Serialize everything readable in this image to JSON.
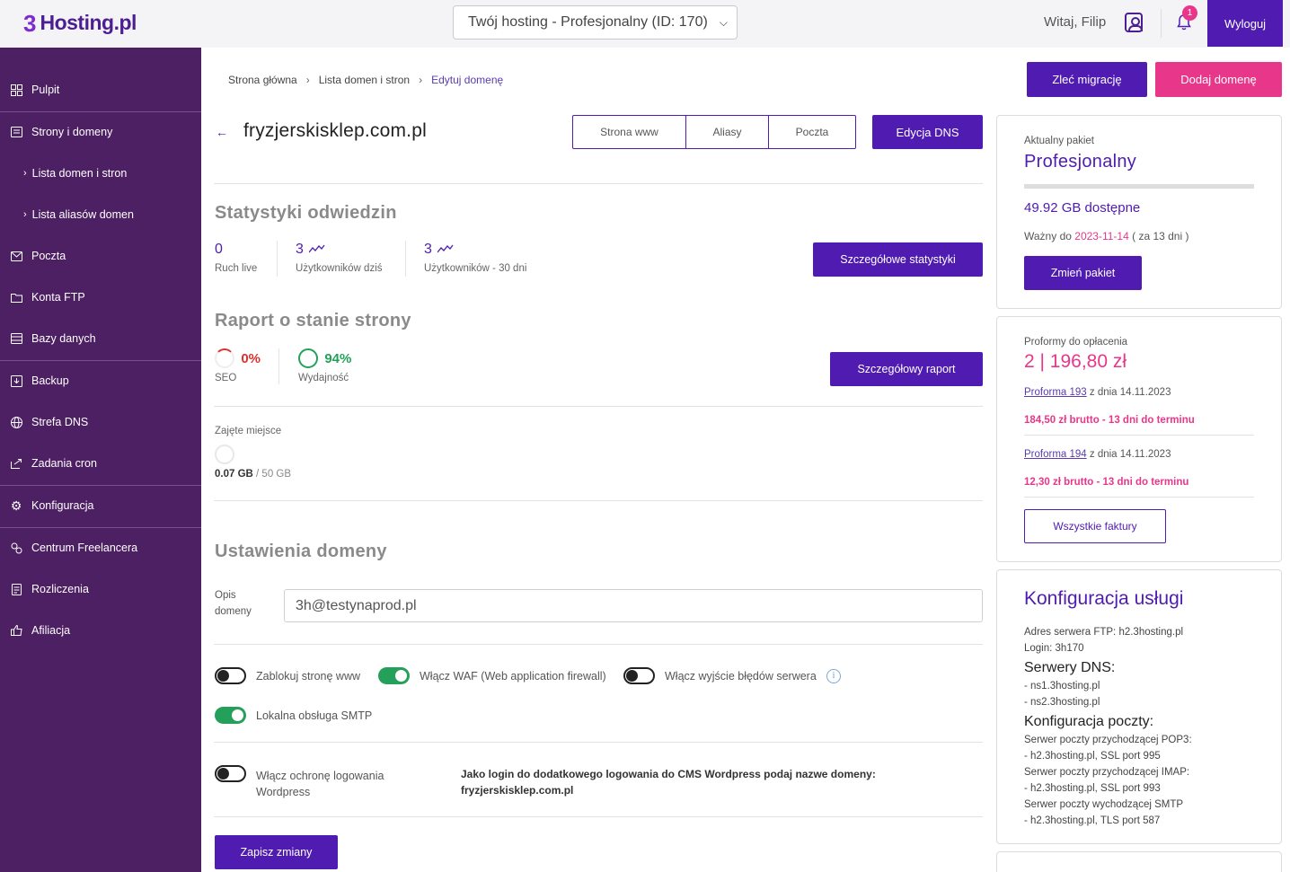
{
  "header": {
    "logo_mark": "3",
    "logo_text": "Hosting.pl",
    "hosting_select": "Twój hosting - Profesjonalny (ID: 170)",
    "greeting": "Witaj, Filip",
    "notifications_count": "1",
    "logout_label": "Wyloguj"
  },
  "sidebar": {
    "items": [
      {
        "label": "Pulpit",
        "icon": "dashboard-icon"
      },
      {
        "label": "Strony i domeny",
        "icon": "globe-list-icon"
      },
      {
        "label": "Lista domen i stron",
        "icon": "chevron-right-icon"
      },
      {
        "label": "Lista aliasów domen",
        "icon": "chevron-right-icon"
      },
      {
        "label": "Poczta",
        "icon": "mail-icon"
      },
      {
        "label": "Konta FTP",
        "icon": "folder-icon"
      },
      {
        "label": "Bazy danych",
        "icon": "database-icon"
      },
      {
        "label": "Backup",
        "icon": "backup-icon"
      },
      {
        "label": "Strefa DNS",
        "icon": "dns-icon"
      },
      {
        "label": "Zadania cron",
        "icon": "cron-icon"
      },
      {
        "label": "Konfiguracja",
        "icon": "gear-icon"
      },
      {
        "label": "Centrum Freelancera",
        "icon": "freelancer-icon"
      },
      {
        "label": "Rozliczenia",
        "icon": "invoice-icon"
      },
      {
        "label": "Afiliacja",
        "icon": "thumbs-up-icon"
      }
    ]
  },
  "breadcrumb": {
    "items": [
      "Strona główna",
      "Lista domen i stron",
      "Edytuj domenę"
    ]
  },
  "actions": {
    "migrate_label": "Zleć migrację",
    "add_domain_label": "Dodaj domenę"
  },
  "domain": {
    "name": "fryzjerskisklep.com.pl",
    "tabs": [
      "Strona www",
      "Aliasy",
      "Poczta"
    ],
    "dns_button": "Edycja DNS"
  },
  "stats": {
    "title": "Statystyki odwiedzin",
    "items": [
      {
        "value": "0",
        "label": "Ruch live"
      },
      {
        "value": "3",
        "label": "Użytkowników dziś"
      },
      {
        "value": "3",
        "label": "Użytkowników - 30 dni"
      }
    ],
    "button": "Szczegółowe statystyki"
  },
  "report": {
    "title": "Raport o stanie strony",
    "seo_value": "0%",
    "seo_label": "SEO",
    "perf_value": "94%",
    "perf_label": "Wydajność",
    "button": "Szczegółowy raport"
  },
  "disk": {
    "label": "Zajęte miejsce",
    "used": "0.07 GB",
    "total": "/ 50 GB"
  },
  "settings": {
    "title": "Ustawienia domeny",
    "desc_label": "Opis domeny",
    "desc_value": "3h@testynaprod.pl",
    "toggles": [
      {
        "label": "Zablokuj stronę www",
        "on": false
      },
      {
        "label": "Włącz WAF (Web application firewall)",
        "on": true
      },
      {
        "label": "Włącz wyjście błędów serwera",
        "on": false
      },
      {
        "label": "Lokalna obsługa SMTP",
        "on": true
      },
      {
        "label": "Włącz ochronę logowania Wordpress",
        "on": false
      }
    ],
    "wp_note_line1": "Jako login do dodatkowego logowania do CMS Wordpress podaj nazwe domeny:",
    "wp_note_line2": "fryzjerskisklep.com.pl",
    "save_label": "Zapisz zmiany"
  },
  "package": {
    "heading": "Aktualny pakiet",
    "name": "Profesjonalny",
    "available": "49.92 GB dostępne",
    "valid_prefix": "Ważny do",
    "valid_date": "2023-11-14",
    "valid_suffix": "( za 13 dni )",
    "change_button": "Zmień pakiet"
  },
  "proforma": {
    "heading": "Proformy do opłacenia",
    "total": "2 | 196,80 zł",
    "items": [
      {
        "link": "Proforma 193",
        "date": "z dnia 14.11.2023",
        "due": "184,50 zł brutto - 13 dni do terminu"
      },
      {
        "link": "Proforma 194",
        "date": "z dnia 14.11.2023",
        "due": "12,30 zł brutto - 13 dni do terminu"
      }
    ],
    "all_button": "Wszystkie faktury"
  },
  "config": {
    "title": "Konfiguracja usługi",
    "ftp_server": "Adres serwera FTP: h2.3hosting.pl",
    "login": "Login: 3h170",
    "dns_heading": "Serwery DNS:",
    "dns1": "- ns1.3hosting.pl",
    "dns2": "- ns2.3hosting.pl",
    "mail_heading": "Konfiguracja poczty:",
    "pop3_label": "Serwer poczty przychodzącej POP3:",
    "pop3_value": "- h2.3hosting.pl, SSL port 995",
    "imap_label": "Serwer poczty przychodzącej IMAP:",
    "imap_value": "- h2.3hosting.pl, SSL port 993",
    "smtp_label": "Serwer poczty wychodzącej SMTP",
    "smtp_value": "- h2.3hosting.pl, TLS port 587"
  },
  "colors": {
    "primary": "#4f1bb0",
    "accent": "#e8378a",
    "sidebar": "#4d1f63",
    "success": "#25a05a"
  }
}
